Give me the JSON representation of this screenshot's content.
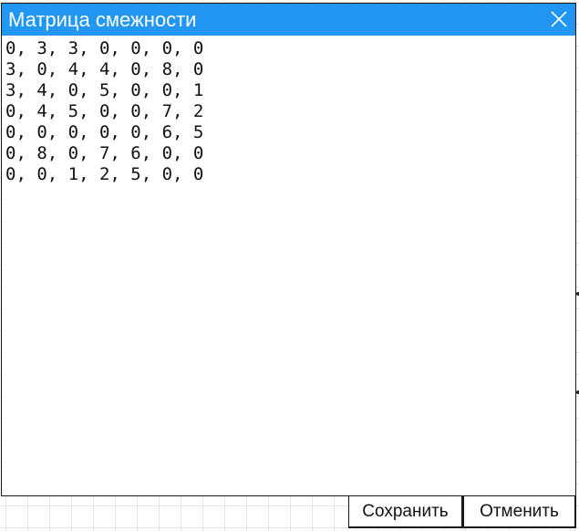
{
  "dialog": {
    "title": "Матрица смежности",
    "close_icon": "close-icon",
    "matrix_text": "0, 3, 3, 0, 0, 0, 0\n3, 0, 4, 4, 0, 8, 0\n3, 4, 0, 5, 0, 0, 1\n0, 4, 5, 0, 0, 7, 2\n0, 0, 0, 0, 0, 6, 5\n0, 8, 0, 7, 6, 0, 0\n0, 0, 1, 2, 5, 0, 0",
    "save_label": "Сохранить",
    "cancel_label": "Отменить"
  },
  "colors": {
    "titlebar": "#2196f3",
    "title_text": "#ffffff",
    "grid_line": "#e4e4e4"
  }
}
